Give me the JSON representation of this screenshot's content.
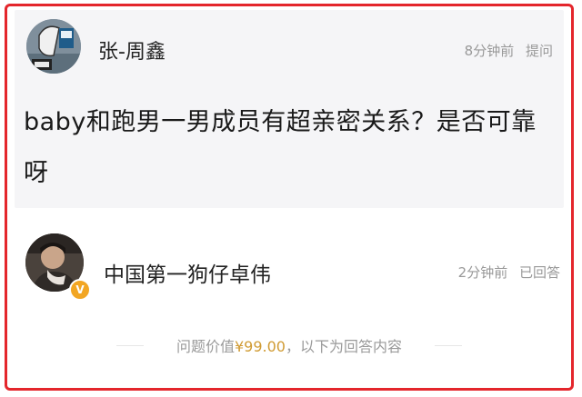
{
  "question": {
    "asker_name": "张-周鑫",
    "time": "8分钟前",
    "action": "提问",
    "text": "baby和跑男一男成员有超亲密关系？是否可靠呀"
  },
  "answer": {
    "answerer_name": "中国第一狗仔卓伟",
    "time": "2分钟前",
    "status": "已回答",
    "verified_badge": "V"
  },
  "price": {
    "prefix": "问题价值",
    "amount": "¥99.00",
    "suffix": "，以下为回答内容"
  },
  "colors": {
    "frame_border": "#e4262c",
    "price_accent": "#d09b33",
    "badge": "#f2a623"
  }
}
